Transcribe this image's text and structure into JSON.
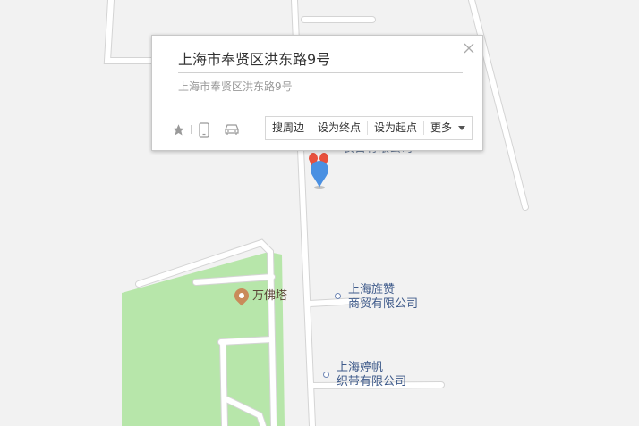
{
  "map": {
    "colors": {
      "background": "#f2f2f2",
      "road": "#ffffff",
      "road_edge": "#d6d6d6",
      "park": "#b7e6aa",
      "marker": "#4a90e2"
    },
    "pois": [
      {
        "name": "万佛塔",
        "type": "park"
      },
      {
        "line1": "上海旌赞",
        "line2": "商贸有限公司",
        "type": "company"
      },
      {
        "line1": "上海婷帆",
        "line2": "织带有限公司",
        "type": "company"
      }
    ],
    "hidden_label_fragment": "农日有限公司"
  },
  "popup": {
    "title": "上海市奉贤区洪东路9号",
    "address": "上海市奉贤区洪东路9号",
    "icons": [
      "star-icon",
      "phone-icon",
      "car-icon"
    ],
    "actions": {
      "search_nearby": "搜周边",
      "set_destination": "设为终点",
      "set_origin": "设为起点",
      "more": "更多"
    }
  }
}
